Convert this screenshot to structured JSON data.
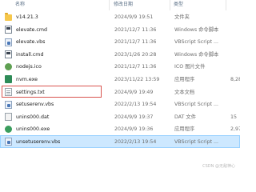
{
  "columns": {
    "name": "名称",
    "date": "修改日期",
    "type": "类型",
    "size": "大小"
  },
  "files": [
    {
      "name": "v14.21.3",
      "date": "2024/9/9 19:51",
      "type": "文件夹",
      "size": "",
      "icon": "folder-icon"
    },
    {
      "name": "elevate.cmd",
      "date": "2021/12/7 11:36",
      "type": "Windows 命令脚本",
      "size": "",
      "icon": "cmd-file-icon"
    },
    {
      "name": "elevate.vbs",
      "date": "2021/12/7 11:36",
      "type": "VBScript Script ...",
      "size": "",
      "icon": "vbs-file-icon"
    },
    {
      "name": "install.cmd",
      "date": "2023/1/26 20:28",
      "type": "Windows 命令脚本",
      "size": "",
      "icon": "cmd-file-icon"
    },
    {
      "name": "nodejs.ico",
      "date": "2021/12/7 11:36",
      "type": "ICO 图片文件",
      "size": "",
      "icon": "ico-file-icon"
    },
    {
      "name": "nvm.exe",
      "date": "2023/11/22 13:59",
      "type": "应用程序",
      "size": "8,28",
      "icon": "exe-file-icon"
    },
    {
      "name": "settings.txt",
      "date": "2024/9/9 19:49",
      "type": "文本文档",
      "size": "",
      "icon": "txt-file-icon",
      "highlighted": true
    },
    {
      "name": "setuserenv.vbs",
      "date": "2022/2/13 19:54",
      "type": "VBScript Script ...",
      "size": "",
      "icon": "vbs-file-icon"
    },
    {
      "name": "unins000.dat",
      "date": "2024/9/9 19:37",
      "type": "DAT 文件",
      "size": "15",
      "icon": "dat-file-icon"
    },
    {
      "name": "unins000.exe",
      "date": "2024/9/9 19:36",
      "type": "应用程序",
      "size": "2,97",
      "icon": "uninstall-exe-icon"
    },
    {
      "name": "unsetuserenv.vbs",
      "date": "2022/2/13 19:54",
      "type": "VBScript Script ...",
      "size": "",
      "icon": "vbs-file-icon",
      "selected": true
    }
  ],
  "watermark": "CSDN @无敌神心"
}
